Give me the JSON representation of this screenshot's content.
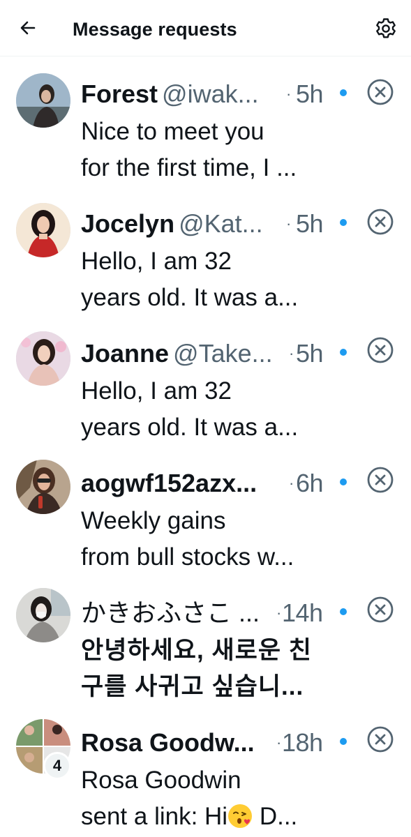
{
  "header": {
    "title": "Message requests",
    "back_icon": "arrow-left-icon",
    "settings_icon": "gear-icon"
  },
  "colors": {
    "unread_dot": "#1d9bf0",
    "secondary_text": "#536471",
    "primary_text": "#0f1419"
  },
  "requests": [
    {
      "name": "Forest",
      "handle": "@iwak...",
      "separator": "·",
      "time": "5h",
      "preview_line1": "Nice to meet you",
      "preview_line2": "for the first time, I ..."
    },
    {
      "name": "Jocelyn",
      "handle": "@Kat...",
      "separator": "·",
      "time": "5h",
      "preview_line1": "Hello, I am 32",
      "preview_line2": "years old. It was a..."
    },
    {
      "name": "Joanne",
      "handle": "@Take...",
      "separator": "·",
      "time": "5h",
      "preview_line1": "Hello, I am 32",
      "preview_line2": "years old. It was a..."
    },
    {
      "name": "aogwf152azx...",
      "handle": "",
      "separator": "·",
      "time": "6h",
      "preview_line1": "Weekly gains",
      "preview_line2": "from bull stocks w..."
    },
    {
      "name": "かきおふさこ ...",
      "handle": "",
      "separator": "·",
      "time": "14h",
      "preview_line1": "안녕하세요, 새로운 친",
      "preview_line2": "구를 사귀고 싶습니..."
    },
    {
      "name": "Rosa Goodw...",
      "handle": "",
      "separator": "·",
      "time": "18h",
      "preview_line1": "Rosa Goodwin",
      "preview_line2_before": "sent a link: Hi",
      "preview_line2_emoji": "kissing-face-emoji",
      "preview_line2_after": " D...",
      "group_count": "4"
    }
  ]
}
